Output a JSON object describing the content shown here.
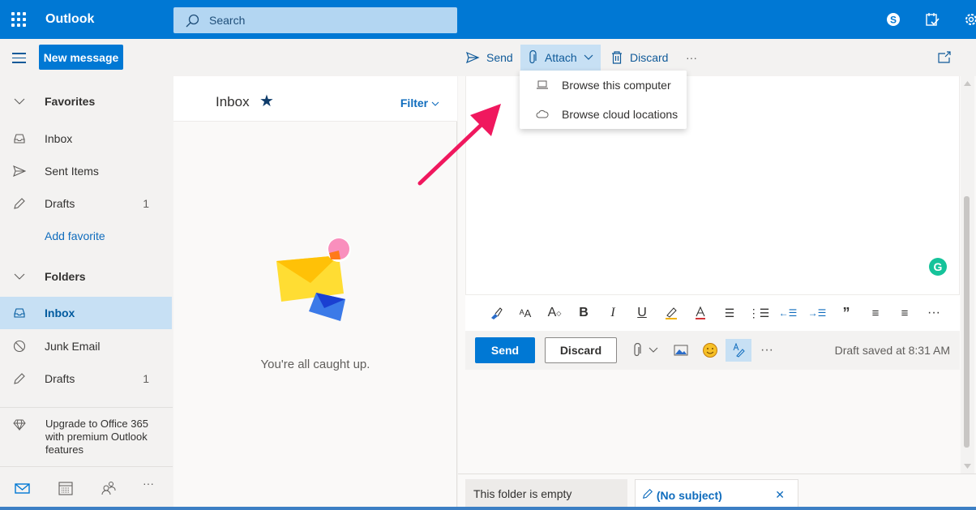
{
  "app": {
    "title": "Outlook"
  },
  "search": {
    "placeholder": "Search"
  },
  "header_icons": [
    "skype-icon",
    "my-day-icon",
    "settings-icon"
  ],
  "toolbar": {
    "new_message": "New message",
    "send": "Send",
    "attach": "Attach",
    "discard": "Discard",
    "more": "···"
  },
  "attach_menu": {
    "items": [
      {
        "label": "Browse this computer",
        "icon": "laptop-icon"
      },
      {
        "label": "Browse cloud locations",
        "icon": "cloud-icon"
      }
    ]
  },
  "sidebar": {
    "favorites": {
      "label": "Favorites",
      "items": [
        {
          "label": "Inbox",
          "count": ""
        },
        {
          "label": "Sent Items",
          "count": ""
        },
        {
          "label": "Drafts",
          "count": "1"
        }
      ],
      "add_favorite": "Add favorite"
    },
    "folders": {
      "label": "Folders",
      "items": [
        {
          "label": "Inbox",
          "count": "",
          "selected": true
        },
        {
          "label": "Junk Email",
          "count": ""
        },
        {
          "label": "Drafts",
          "count": "1"
        }
      ]
    },
    "upgrade": "Upgrade to Office 365 with premium Outlook features",
    "bottom_nav": [
      "mail-icon",
      "calendar-icon",
      "people-icon",
      "more-icon"
    ],
    "bottom_more": "···"
  },
  "message_list": {
    "title": "Inbox",
    "filter": "Filter",
    "empty_text": "You're all caught up."
  },
  "compose": {
    "send": "Send",
    "discard": "Discard",
    "more": "···",
    "draft_status": "Draft saved at 8:31 AM",
    "grammarly": "G",
    "format_tools": [
      "format-painter",
      "font-size",
      "grow-font",
      "bold",
      "italic",
      "underline",
      "highlight",
      "font-color",
      "bullets",
      "numbering",
      "decrease-indent",
      "increase-indent",
      "quote",
      "align-left",
      "align-center",
      "more"
    ]
  },
  "bottom_tabs": {
    "folder_tab": "This folder is empty",
    "draft_tab": "(No subject)",
    "close": "✕"
  },
  "colors": {
    "brand": "#0078d4",
    "annotation_arrow": "#f0185e",
    "grammarly": "#15c39a"
  }
}
